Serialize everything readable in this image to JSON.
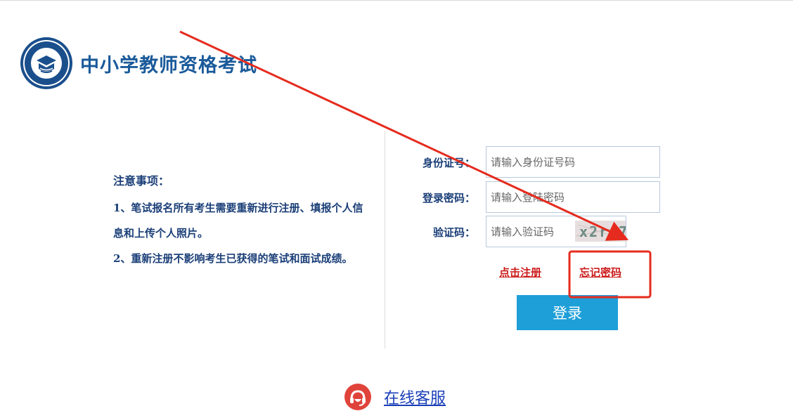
{
  "header": {
    "title": "中小学教师资格考试",
    "logo_icon": "exam-seal-logo-icon"
  },
  "notice": {
    "title": "注意事项：",
    "items": [
      "1、笔试报名所有考生需要重新进行注册、填报个人信息和上传个人照片。",
      "2、重新注册不影响考生已获得的笔试和面试成绩。"
    ]
  },
  "form": {
    "id_label": "身份证号：",
    "id_placeholder": "请输入身份证号码",
    "password_label": "登录密码：",
    "password_placeholder": "请输入登陆密码",
    "captcha_label": "验证码：",
    "captcha_placeholder": "请输入验证码",
    "captcha_text": "x2r 7",
    "register_link": "点击注册",
    "forgot_link": "忘记密码",
    "login_button": "登录"
  },
  "footer": {
    "service_link": "在线客服",
    "service_icon": "headset-icon"
  },
  "annotation": {
    "arrow_color": "#e52b1e",
    "highlight_color": "#e52b1e",
    "target": "forgot-password-link"
  },
  "colors": {
    "primary_text": "#1b3f78",
    "link_red": "#cc1b1b",
    "button_blue": "#1e9fd8",
    "service_blue": "#1a3fb8",
    "service_icon_red": "#e0433a"
  }
}
